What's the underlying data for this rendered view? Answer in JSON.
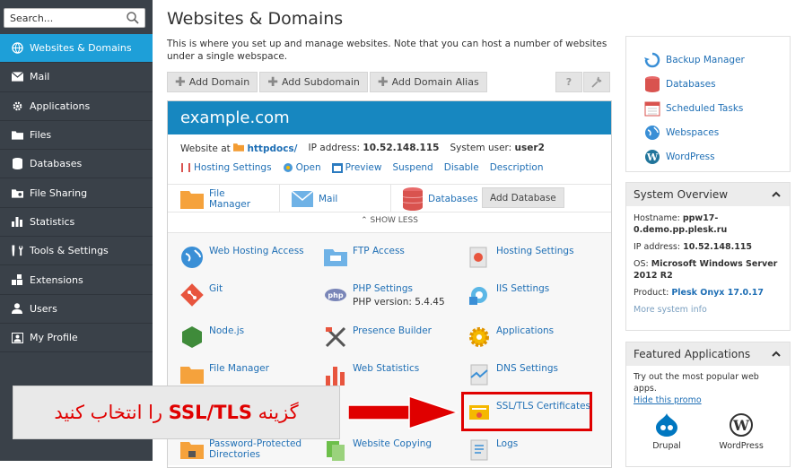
{
  "search": {
    "placeholder": "Search..."
  },
  "sidebar": {
    "items": [
      {
        "label": "Websites & Domains",
        "icon": "globe-icon"
      },
      {
        "label": "Mail",
        "icon": "mail-icon"
      },
      {
        "label": "Applications",
        "icon": "gear-icon"
      },
      {
        "label": "Files",
        "icon": "folder-icon"
      },
      {
        "label": "Databases",
        "icon": "database-icon"
      },
      {
        "label": "File Sharing",
        "icon": "file-sharing-icon"
      },
      {
        "label": "Statistics",
        "icon": "bar-chart-icon"
      },
      {
        "label": "Tools & Settings",
        "icon": "tools-icon"
      },
      {
        "label": "Extensions",
        "icon": "extensions-icon"
      },
      {
        "label": "Users",
        "icon": "user-icon"
      },
      {
        "label": "My Profile",
        "icon": "profile-icon"
      }
    ]
  },
  "main": {
    "title": "Websites & Domains",
    "intro": "This is where you set up and manage websites. Note that you can host a number of websites under a single webspace.",
    "toolbar": {
      "add_domain": "Add Domain",
      "add_subdomain": "Add Subdomain",
      "add_alias": "Add Domain Alias",
      "help": "?"
    }
  },
  "domain": {
    "name": "example.com",
    "website_at_label": "Website at",
    "website_at_value": "httpdocs/",
    "ip_label": "IP address:",
    "ip_value": "10.52.148.115",
    "user_label": "System user:",
    "user_value": "user2",
    "links": [
      "Hosting Settings",
      "Open",
      "Preview",
      "Suspend",
      "Disable",
      "Description"
    ],
    "quick": {
      "file_manager": "File Manager",
      "mail": "Mail",
      "databases": "Databases",
      "add_database": "Add Database"
    },
    "show_less": "SHOW LESS",
    "features": {
      "web_hosting_access": "Web Hosting Access",
      "ftp_access": "FTP Access",
      "hosting_settings": "Hosting Settings",
      "git": "Git",
      "php_settings": "PHP Settings",
      "php_version": "PHP version: 5.4.45",
      "iis_settings": "IIS Settings",
      "nodejs": "Node.js",
      "presence_builder": "Presence Builder",
      "applications": "Applications",
      "file_manager": "File Manager",
      "web_statistics": "Web Statistics",
      "dns_settings": "DNS Settings",
      "ssl_tls": "SSL/TLS Certificates",
      "password_protected": "Password-Protected Directories",
      "website_copying": "Website Copying",
      "logs": "Logs"
    }
  },
  "right": {
    "links": [
      "Backup Manager",
      "Databases",
      "Scheduled Tasks",
      "Webspaces",
      "WordPress"
    ],
    "system_overview": {
      "title": "System Overview",
      "hostname_label": "Hostname:",
      "hostname_value": "ppw17-0.demo.pp.plesk.ru",
      "ip_label": "IP address:",
      "ip_value": "10.52.148.115",
      "os_label": "OS:",
      "os_value": "Microsoft Windows Server 2012 R2",
      "product_label": "Product:",
      "product_value": "Plesk Onyx 17.0.17",
      "more": "More system info"
    },
    "featured": {
      "title": "Featured Applications",
      "text": "Try out the most popular web apps.",
      "hide": "Hide this promo",
      "apps": [
        "Drupal",
        "WordPress"
      ]
    }
  },
  "annotation": {
    "prefix": "گزینه",
    "ssl": "SSL/TLS",
    "suffix": "را انتخاب کنید"
  },
  "colors": {
    "sidebar": "#3a4149",
    "active": "#1e9fd8",
    "domain_header": "#1787c0",
    "annotation": "#e00000"
  }
}
